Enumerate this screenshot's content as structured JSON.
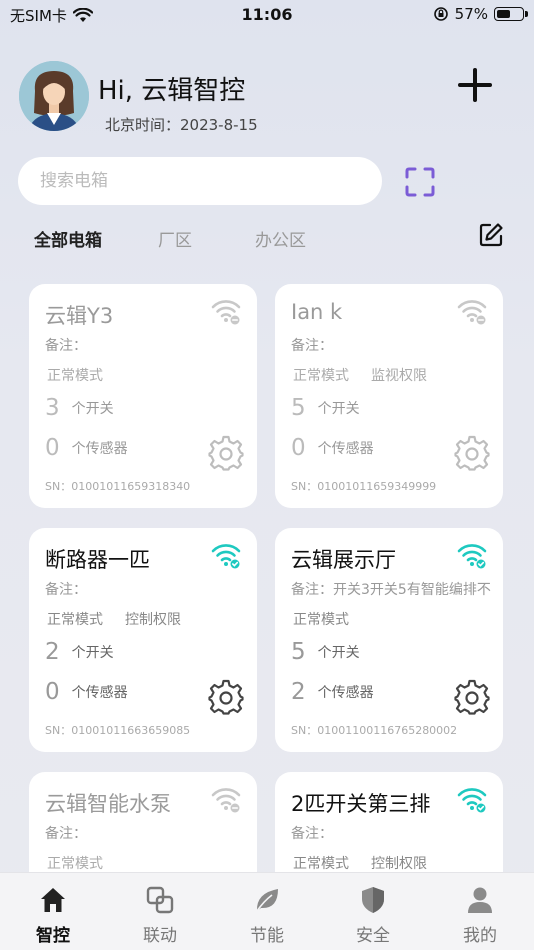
{
  "status_bar": {
    "carrier": "无SIM卡",
    "time": "11:06",
    "battery": "57%",
    "battery_level": 0.57
  },
  "header": {
    "greeting": "Hi, 云辑智控",
    "date": "北京时间：2023-8-15"
  },
  "search": {
    "placeholder": "搜索电箱"
  },
  "tabs": [
    {
      "label": "全部电箱",
      "active": true
    },
    {
      "label": "厂区",
      "active": false
    },
    {
      "label": "办公区",
      "active": false
    }
  ],
  "cards": [
    {
      "name": "云辑Y3",
      "remark": "备注：",
      "tags": [
        "正常模式"
      ],
      "switch_count": "3",
      "switch_label": "个开关",
      "sensor_count": "0",
      "sensor_label": "个传感器",
      "sn": "SN：01001011659318340",
      "online": false
    },
    {
      "name": "Ian k",
      "remark": "备注：",
      "tags": [
        "正常模式",
        "监视权限"
      ],
      "switch_count": "5",
      "switch_label": "个开关",
      "sensor_count": "0",
      "sensor_label": "个传感器",
      "sn": "SN：01001011659349999",
      "online": false
    },
    {
      "name": "断路器一匹",
      "remark": "备注：",
      "tags": [
        "正常模式",
        "控制权限"
      ],
      "switch_count": "2",
      "switch_label": "个开关",
      "sensor_count": "0",
      "sensor_label": "个传感器",
      "sn": "SN：01001011663659085",
      "online": true
    },
    {
      "name": "云辑展示厅",
      "remark": "备注：开关3开关5有智能编排不",
      "tags": [
        "正常模式"
      ],
      "switch_count": "5",
      "switch_label": "个开关",
      "sensor_count": "2",
      "sensor_label": "个传感器",
      "sn": "SN：01001100116765280002",
      "online": true
    },
    {
      "name": "云辑智能水泵",
      "remark": "备注：",
      "tags": [
        "正常模式"
      ],
      "online": false
    },
    {
      "name": "2匹开关第三排",
      "remark": "备注：",
      "tags": [
        "正常模式",
        "控制权限"
      ],
      "online": true
    }
  ],
  "bottom_nav": [
    {
      "label": "智控",
      "icon": "home-icon",
      "active": true
    },
    {
      "label": "联动",
      "icon": "link-icon",
      "active": false
    },
    {
      "label": "节能",
      "icon": "leaf-icon",
      "active": false
    },
    {
      "label": "安全",
      "icon": "shield-icon",
      "active": false
    },
    {
      "label": "我的",
      "icon": "user-icon",
      "active": false
    }
  ],
  "colors": {
    "accent": "#1ec9c0",
    "offline_icon": "#c8c8c8",
    "scan": "#7b5cd6"
  }
}
